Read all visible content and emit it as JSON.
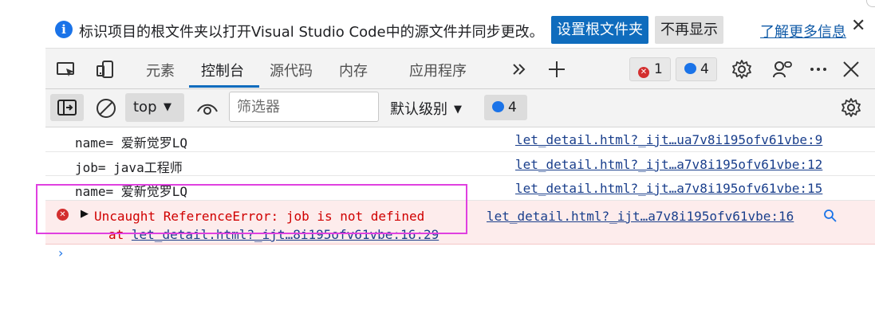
{
  "infobar": {
    "message": "标识项目的根文件夹以打开Visual Studio Code中的源文件并同步更改。",
    "primary_button": "设置根文件夹",
    "secondary_button": "不再显示",
    "learn_more": "了解更多信息",
    "close": "✕"
  },
  "tabs": [
    {
      "label": "元素"
    },
    {
      "label": "控制台"
    },
    {
      "label": "源代码"
    },
    {
      "label": "内存"
    },
    {
      "label": "应用程序"
    }
  ],
  "badges": {
    "errors": "1",
    "messages": "4"
  },
  "toolbar": {
    "context": "top",
    "filter_placeholder": "筛选器",
    "levels": "默认级别",
    "message_count": "4"
  },
  "console": {
    "rows": [
      {
        "message": "name= 爱新觉罗LQ",
        "source": "let_detail.html?_ijt…ua7v8i195ofv61vbe:9"
      },
      {
        "message": "job= java工程师",
        "source": "let_detail.html?_ijt…a7v8i195ofv61vbe:12"
      },
      {
        "message": "name= 爱新觉罗LQ",
        "source": "let_detail.html?_ijt…a7v8i195ofv61vbe:15"
      }
    ],
    "error": {
      "message": "Uncaught ReferenceError: job is not defined",
      "source": "let_detail.html?_ijt…a7v8i195ofv61vbe:16",
      "at_prefix": "at ",
      "at_link": "let_detail.html?_ijt…8i195ofv61vbe:16:29"
    }
  },
  "colors": {
    "accent": "#0f6cbd",
    "error": "#d00000",
    "highlight": "#e040e0",
    "link": "#1a3f8c"
  }
}
